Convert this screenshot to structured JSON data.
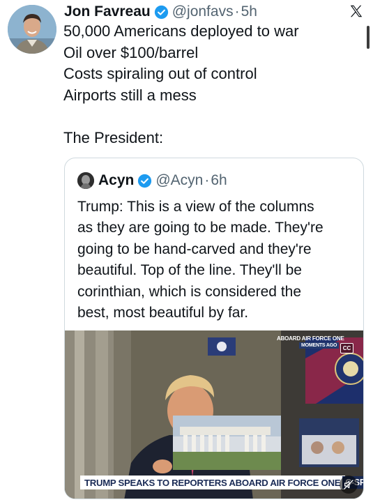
{
  "tweet": {
    "author_name": "Jon Favreau",
    "handle": "@jonfavs",
    "separator": "·",
    "time": "5h",
    "lines": [
      "50,000 Americans deployed to war",
      "Oil over $100/barrel",
      "Costs spiraling out of control",
      "Airports still a mess",
      "",
      "The President:"
    ]
  },
  "quoted": {
    "author_name": "Acyn",
    "handle": "@Acyn",
    "separator": "·",
    "time": "6h",
    "lines": [
      "Trump: This is a view of the columns",
      "as they are going to be made. They're",
      "going to be hand-carved and they're",
      "beautiful. Top of the line. They'll be",
      "corinthian, which is considered the",
      "best, most beautiful by far."
    ]
  },
  "video": {
    "chyron": "TRUMP SPEAKS TO REPORTERS ABOARD AIR FORCE ONE",
    "network": "C-SPAN",
    "corner_title": "ABOARD AIR FORCE ONE",
    "corner_subtitle": "MOMENTS AGO",
    "cc_label": "CC"
  },
  "icons": {
    "close": "x-logo-icon",
    "verified": "verified-badge-icon",
    "mute": "muted-speaker-icon"
  },
  "colors": {
    "verified": "#1d9bf0",
    "secondary_text": "#536471",
    "border": "#cfd9de",
    "chyron_text": "#1a2b56"
  }
}
